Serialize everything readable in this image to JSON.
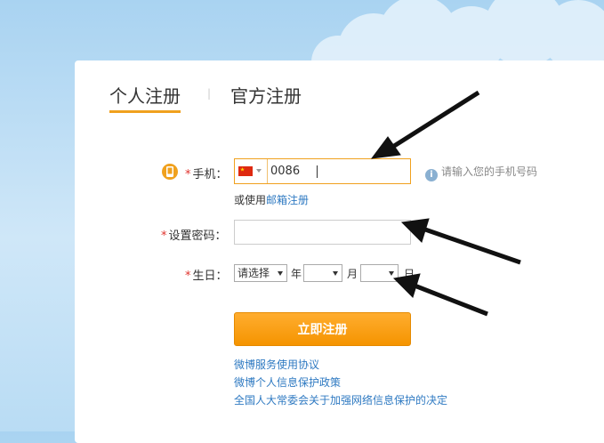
{
  "tabs": [
    {
      "label": "个人注册"
    },
    {
      "label": "官方注册"
    }
  ],
  "tab_separator": "|",
  "phone": {
    "required_mark": "*",
    "label": "手机：",
    "country_code": "0086",
    "hint": "请输入您的手机号码",
    "info_glyph": "i"
  },
  "alt_register": {
    "prefix": "或使用",
    "link": "邮箱注册"
  },
  "password": {
    "required_mark": "*",
    "label": "设置密码：",
    "value": ""
  },
  "birthday": {
    "required_mark": "*",
    "label": "生日：",
    "year_select": "请选择",
    "year_unit": "年",
    "month_select": "",
    "month_unit": "月",
    "day_select": "",
    "day_unit": "日"
  },
  "submit_label": "立即注册",
  "links": [
    {
      "label": "微博服务使用协议"
    },
    {
      "label": "微博个人信息保护政策"
    },
    {
      "label": "全国人大常委会关于加强网络信息保护的决定"
    }
  ],
  "colors": {
    "accent": "#f0a11e",
    "link": "#2f7ac2",
    "required": "#e0322c"
  }
}
